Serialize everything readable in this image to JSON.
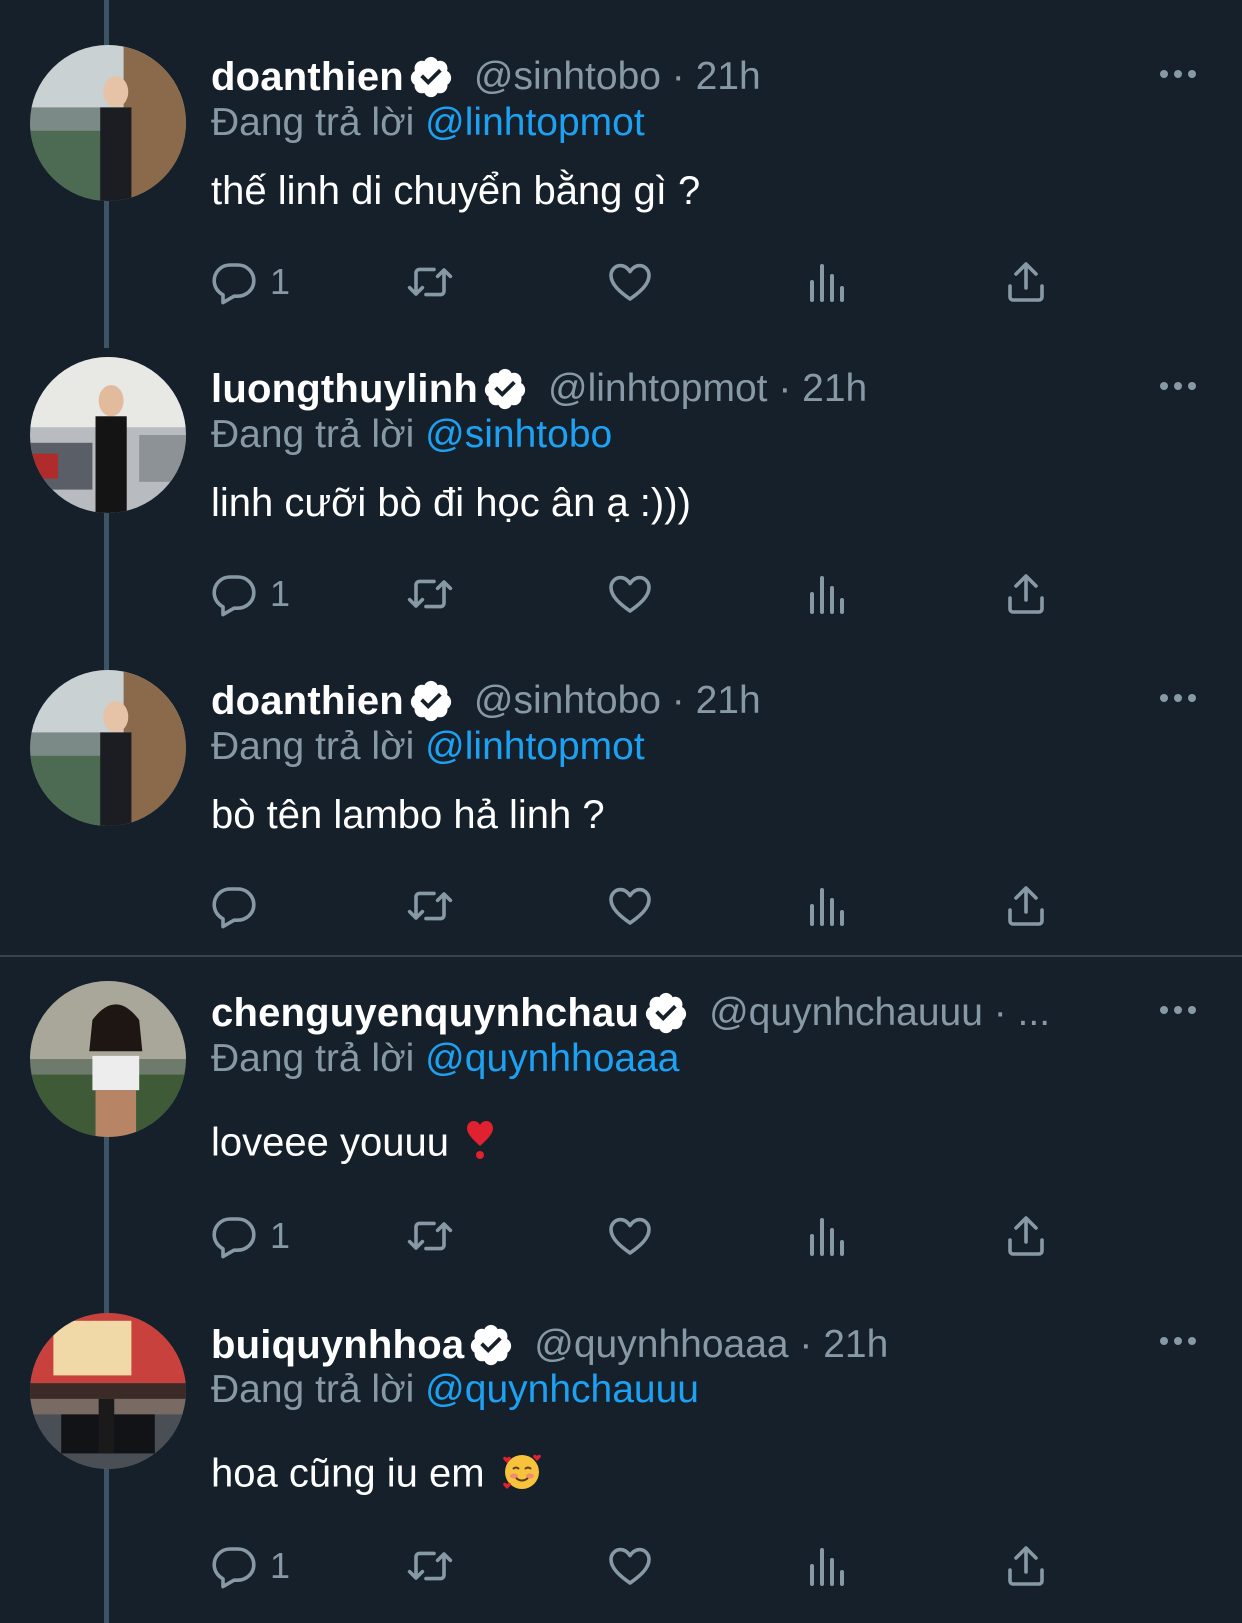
{
  "tweets": [
    {
      "name": "doanthien",
      "handle": "@sinhtobo · 21h",
      "reply_prefix": "Đang trả lời ",
      "reply_to": "@linhtopmot",
      "text": "thế linh di chuyển bằng gì ?",
      "reply_count": "1"
    },
    {
      "name": "luongthuylinh",
      "handle": "@linhtopmot · 21h",
      "reply_prefix": "Đang trả lời ",
      "reply_to": "@sinhtobo",
      "text": "linh cưỡi bò đi học ân ạ :)))",
      "reply_count": "1"
    },
    {
      "name": "doanthien",
      "handle": "@sinhtobo · 21h",
      "reply_prefix": "Đang trả lời ",
      "reply_to": "@linhtopmot",
      "text": "bò tên lambo hả linh ?",
      "reply_count": ""
    },
    {
      "name": "chenguyenquynhchau",
      "handle": "@quynhchauuu · ...",
      "reply_prefix": "Đang trả lời ",
      "reply_to": "@quynhhoaaa",
      "text": "loveee youuu",
      "reply_count": "1"
    },
    {
      "name": "buiquynhhoa",
      "handle": "@quynhhoaaa · 21h",
      "reply_prefix": "Đang trả lời ",
      "reply_to": "@quynhchauuu",
      "text": "hoa cũng iu em",
      "reply_count": "1"
    }
  ],
  "colors": {
    "background": "#15202b",
    "secondary_text": "#8899a6",
    "link": "#1da1f2",
    "thread_line": "#3d5466"
  },
  "icons": [
    "reply-icon",
    "retweet-icon",
    "like-icon",
    "analytics-icon",
    "share-icon",
    "more-icon",
    "verified-badge-icon"
  ]
}
